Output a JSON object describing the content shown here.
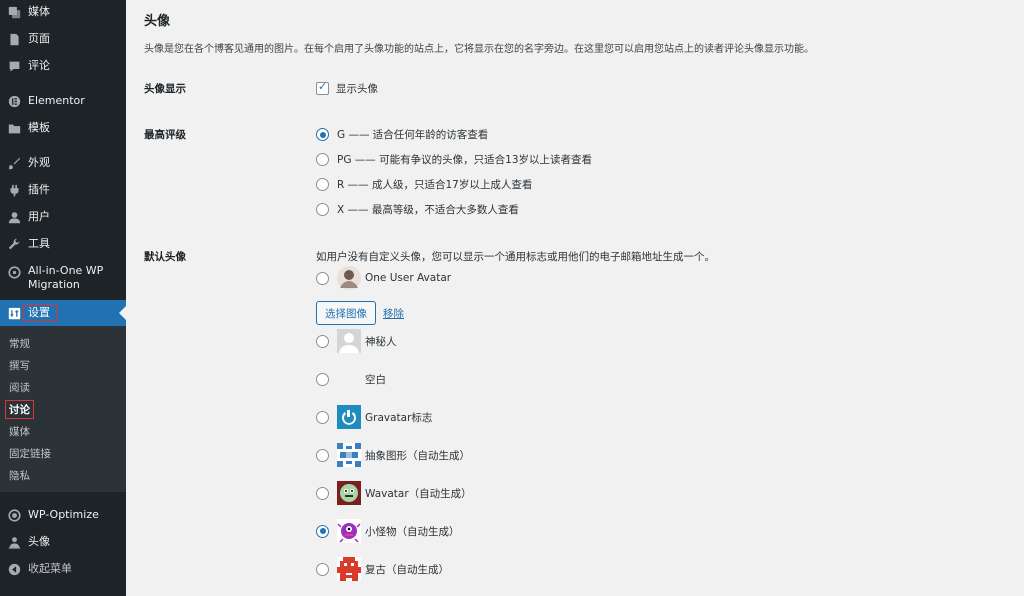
{
  "sidebar": {
    "items": [
      {
        "label": "媒体",
        "icon": "media-icon"
      },
      {
        "label": "页面",
        "icon": "page-icon"
      },
      {
        "label": "评论",
        "icon": "comment-icon"
      },
      {
        "label": "Elementor",
        "icon": "elementor-icon"
      },
      {
        "label": "模板",
        "icon": "folder-icon"
      },
      {
        "label": "外观",
        "icon": "paintbrush-icon"
      },
      {
        "label": "插件",
        "icon": "plugin-icon"
      },
      {
        "label": "用户",
        "icon": "user-icon"
      },
      {
        "label": "工具",
        "icon": "wrench-icon"
      },
      {
        "label": "All-in-One WP",
        "label2": "Migration",
        "icon": "migration-icon"
      },
      {
        "label": "设置",
        "icon": "settings-icon"
      },
      {
        "label": "WP-Optimize",
        "icon": "optimize-icon"
      },
      {
        "label": "头像",
        "icon": "avatar-plugin-icon"
      },
      {
        "label": "收起菜单",
        "icon": "collapse-icon"
      }
    ],
    "submenu": [
      "常规",
      "撰写",
      "阅读",
      "讨论",
      "媒体",
      "固定链接",
      "隐私"
    ]
  },
  "main": {
    "title": "头像",
    "description": "头像是您在各个博客见通用的图片。在每个启用了头像功能的站点上，它将显示在您的名字旁边。在这里您可以启用您站点上的读者评论头像显示功能。",
    "show_avatars": {
      "label": "头像显示",
      "checkbox_label": "显示头像"
    },
    "max_rating": {
      "label": "最高评级",
      "options": [
        "G —— 适合任何年龄的访客查看",
        "PG —— 可能有争议的头像，只适合13岁以上读者查看",
        "R —— 成人级，只适合17岁以上成人查看",
        "X —— 最高等级，不适合大多数人查看"
      ]
    },
    "default_avatar": {
      "label": "默认头像",
      "description": "如用户没有自定义头像，您可以显示一个通用标志或用他们的电子邮箱地址生成一个。",
      "choose_button": "选择图像",
      "remove_link": "移除",
      "options": [
        "One User Avatar",
        "神秘人",
        "空白",
        "Gravatar标志",
        "抽象图形（自动生成）",
        "Wavatar（自动生成）",
        "小怪物（自动生成）",
        "复古（自动生成）"
      ]
    }
  },
  "colors": {
    "accent": "#2271b1",
    "sidebar": "#1d2327",
    "highlight": "#d63638"
  }
}
